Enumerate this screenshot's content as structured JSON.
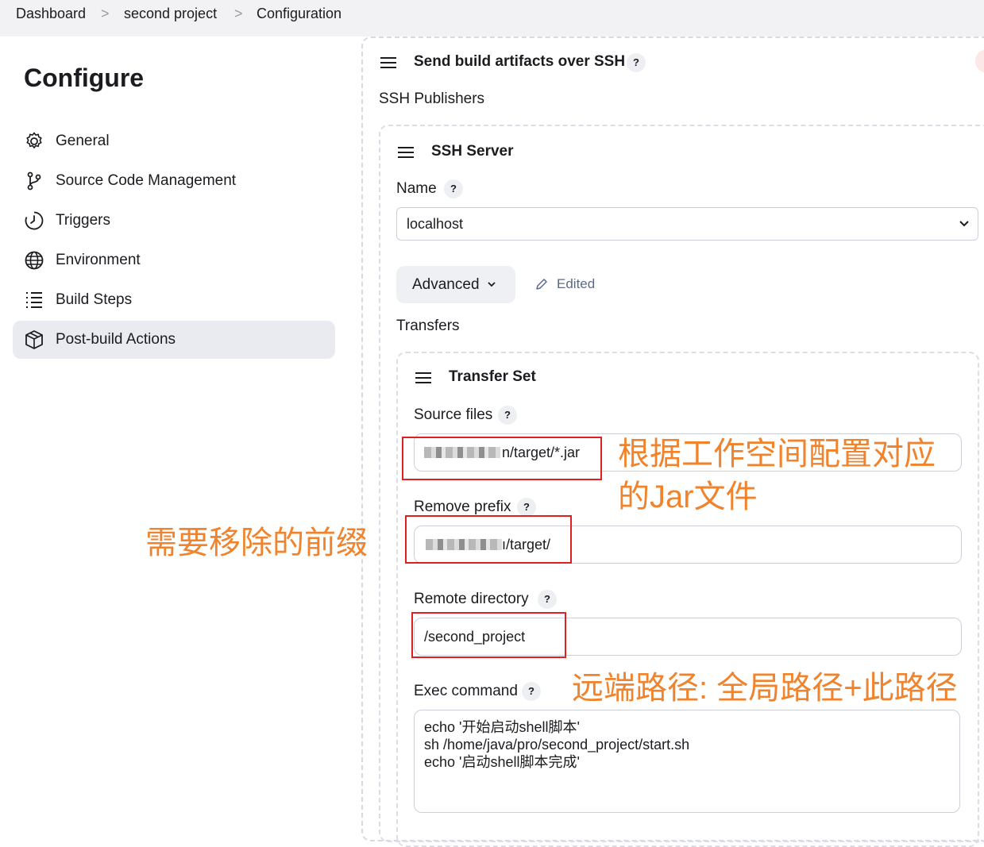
{
  "breadcrumb": [
    "Dashboard",
    "second project",
    "Configuration"
  ],
  "sidebar": {
    "title": "Configure",
    "items": [
      {
        "label": "General",
        "icon": "gear-icon"
      },
      {
        "label": "Source Code Management",
        "icon": "branch-icon"
      },
      {
        "label": "Triggers",
        "icon": "clock-icon"
      },
      {
        "label": "Environment",
        "icon": "globe-icon"
      },
      {
        "label": "Build Steps",
        "icon": "list-icon"
      },
      {
        "label": "Post-build Actions",
        "icon": "package-icon",
        "active": true
      }
    ]
  },
  "section": {
    "title": "Send build artifacts over SSH",
    "help": "?",
    "publishers_label": "SSH Publishers",
    "server": {
      "title": "SSH Server",
      "name_label": "Name",
      "name_value": "localhost",
      "advanced_label": "Advanced",
      "edited_label": "Edited",
      "transfers_label": "Transfers",
      "transfer_set": {
        "title": "Transfer Set",
        "source_files_label": "Source files",
        "source_files_value": "n/target/*.jar",
        "remove_prefix_label": "Remove prefix",
        "remove_prefix_value": "ı/target/",
        "remote_directory_label": "Remote directory",
        "remote_directory_value": "/second_project",
        "exec_command_label": "Exec command",
        "exec_command_value": "echo '开始启动shell脚本'\nsh /home/java/pro/second_project/start.sh\necho '启动shell脚本完成'"
      }
    }
  },
  "annotations": {
    "source_note_line1": "根据工作空间配置对应",
    "source_note_line2": "的Jar文件",
    "prefix_note": "需要移除的前缀",
    "remote_note": "远端路径: 全局路径+此路径"
  },
  "colors": {
    "annotation": "#f0832b",
    "highlight_box": "#e02020",
    "active_nav_bg": "#e9ebf1",
    "edited": "#5b6a8a"
  }
}
